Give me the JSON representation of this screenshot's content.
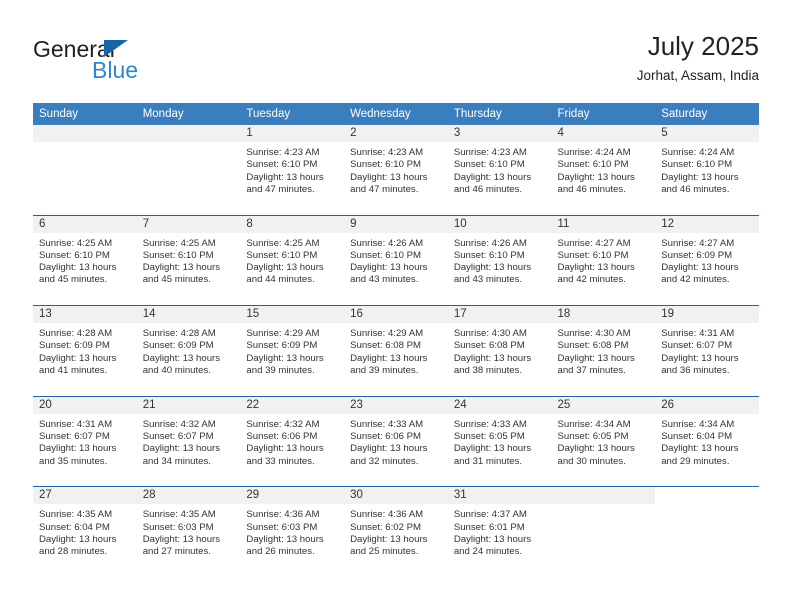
{
  "brand": {
    "name_part1": "General",
    "name_part2": "Blue",
    "triangle_color": "#1565a8",
    "blue_color": "#2d86d0"
  },
  "header": {
    "title": "July 2025",
    "subtitle": "Jorhat, Assam, India"
  },
  "theme": {
    "header_blue": "#3a7ebd",
    "row_rule_blue": "#1f62a8",
    "daynum_band": "#f1f1f1"
  },
  "weekdays": [
    "Sunday",
    "Monday",
    "Tuesday",
    "Wednesday",
    "Thursday",
    "Friday",
    "Saturday"
  ],
  "labels": {
    "sunrise_prefix": "Sunrise:",
    "sunset_prefix": "Sunset:",
    "daylight_prefix": "Daylight:"
  },
  "weeks": [
    [
      {
        "day": "",
        "line1": "",
        "line2": "",
        "line3": "",
        "line4": ""
      },
      {
        "day": "",
        "line1": "",
        "line2": "",
        "line3": "",
        "line4": ""
      },
      {
        "day": "1",
        "line1": "Sunrise: 4:23 AM",
        "line2": "Sunset: 6:10 PM",
        "line3": "Daylight: 13 hours",
        "line4": "and 47 minutes."
      },
      {
        "day": "2",
        "line1": "Sunrise: 4:23 AM",
        "line2": "Sunset: 6:10 PM",
        "line3": "Daylight: 13 hours",
        "line4": "and 47 minutes."
      },
      {
        "day": "3",
        "line1": "Sunrise: 4:23 AM",
        "line2": "Sunset: 6:10 PM",
        "line3": "Daylight: 13 hours",
        "line4": "and 46 minutes."
      },
      {
        "day": "4",
        "line1": "Sunrise: 4:24 AM",
        "line2": "Sunset: 6:10 PM",
        "line3": "Daylight: 13 hours",
        "line4": "and 46 minutes."
      },
      {
        "day": "5",
        "line1": "Sunrise: 4:24 AM",
        "line2": "Sunset: 6:10 PM",
        "line3": "Daylight: 13 hours",
        "line4": "and 46 minutes."
      }
    ],
    [
      {
        "day": "6",
        "line1": "Sunrise: 4:25 AM",
        "line2": "Sunset: 6:10 PM",
        "line3": "Daylight: 13 hours",
        "line4": "and 45 minutes."
      },
      {
        "day": "7",
        "line1": "Sunrise: 4:25 AM",
        "line2": "Sunset: 6:10 PM",
        "line3": "Daylight: 13 hours",
        "line4": "and 45 minutes."
      },
      {
        "day": "8",
        "line1": "Sunrise: 4:25 AM",
        "line2": "Sunset: 6:10 PM",
        "line3": "Daylight: 13 hours",
        "line4": "and 44 minutes."
      },
      {
        "day": "9",
        "line1": "Sunrise: 4:26 AM",
        "line2": "Sunset: 6:10 PM",
        "line3": "Daylight: 13 hours",
        "line4": "and 43 minutes."
      },
      {
        "day": "10",
        "line1": "Sunrise: 4:26 AM",
        "line2": "Sunset: 6:10 PM",
        "line3": "Daylight: 13 hours",
        "line4": "and 43 minutes."
      },
      {
        "day": "11",
        "line1": "Sunrise: 4:27 AM",
        "line2": "Sunset: 6:10 PM",
        "line3": "Daylight: 13 hours",
        "line4": "and 42 minutes."
      },
      {
        "day": "12",
        "line1": "Sunrise: 4:27 AM",
        "line2": "Sunset: 6:09 PM",
        "line3": "Daylight: 13 hours",
        "line4": "and 42 minutes."
      }
    ],
    [
      {
        "day": "13",
        "line1": "Sunrise: 4:28 AM",
        "line2": "Sunset: 6:09 PM",
        "line3": "Daylight: 13 hours",
        "line4": "and 41 minutes."
      },
      {
        "day": "14",
        "line1": "Sunrise: 4:28 AM",
        "line2": "Sunset: 6:09 PM",
        "line3": "Daylight: 13 hours",
        "line4": "and 40 minutes."
      },
      {
        "day": "15",
        "line1": "Sunrise: 4:29 AM",
        "line2": "Sunset: 6:09 PM",
        "line3": "Daylight: 13 hours",
        "line4": "and 39 minutes."
      },
      {
        "day": "16",
        "line1": "Sunrise: 4:29 AM",
        "line2": "Sunset: 6:08 PM",
        "line3": "Daylight: 13 hours",
        "line4": "and 39 minutes."
      },
      {
        "day": "17",
        "line1": "Sunrise: 4:30 AM",
        "line2": "Sunset: 6:08 PM",
        "line3": "Daylight: 13 hours",
        "line4": "and 38 minutes."
      },
      {
        "day": "18",
        "line1": "Sunrise: 4:30 AM",
        "line2": "Sunset: 6:08 PM",
        "line3": "Daylight: 13 hours",
        "line4": "and 37 minutes."
      },
      {
        "day": "19",
        "line1": "Sunrise: 4:31 AM",
        "line2": "Sunset: 6:07 PM",
        "line3": "Daylight: 13 hours",
        "line4": "and 36 minutes."
      }
    ],
    [
      {
        "day": "20",
        "line1": "Sunrise: 4:31 AM",
        "line2": "Sunset: 6:07 PM",
        "line3": "Daylight: 13 hours",
        "line4": "and 35 minutes."
      },
      {
        "day": "21",
        "line1": "Sunrise: 4:32 AM",
        "line2": "Sunset: 6:07 PM",
        "line3": "Daylight: 13 hours",
        "line4": "and 34 minutes."
      },
      {
        "day": "22",
        "line1": "Sunrise: 4:32 AM",
        "line2": "Sunset: 6:06 PM",
        "line3": "Daylight: 13 hours",
        "line4": "and 33 minutes."
      },
      {
        "day": "23",
        "line1": "Sunrise: 4:33 AM",
        "line2": "Sunset: 6:06 PM",
        "line3": "Daylight: 13 hours",
        "line4": "and 32 minutes."
      },
      {
        "day": "24",
        "line1": "Sunrise: 4:33 AM",
        "line2": "Sunset: 6:05 PM",
        "line3": "Daylight: 13 hours",
        "line4": "and 31 minutes."
      },
      {
        "day": "25",
        "line1": "Sunrise: 4:34 AM",
        "line2": "Sunset: 6:05 PM",
        "line3": "Daylight: 13 hours",
        "line4": "and 30 minutes."
      },
      {
        "day": "26",
        "line1": "Sunrise: 4:34 AM",
        "line2": "Sunset: 6:04 PM",
        "line3": "Daylight: 13 hours",
        "line4": "and 29 minutes."
      }
    ],
    [
      {
        "day": "27",
        "line1": "Sunrise: 4:35 AM",
        "line2": "Sunset: 6:04 PM",
        "line3": "Daylight: 13 hours",
        "line4": "and 28 minutes."
      },
      {
        "day": "28",
        "line1": "Sunrise: 4:35 AM",
        "line2": "Sunset: 6:03 PM",
        "line3": "Daylight: 13 hours",
        "line4": "and 27 minutes."
      },
      {
        "day": "29",
        "line1": "Sunrise: 4:36 AM",
        "line2": "Sunset: 6:03 PM",
        "line3": "Daylight: 13 hours",
        "line4": "and 26 minutes."
      },
      {
        "day": "30",
        "line1": "Sunrise: 4:36 AM",
        "line2": "Sunset: 6:02 PM",
        "line3": "Daylight: 13 hours",
        "line4": "and 25 minutes."
      },
      {
        "day": "31",
        "line1": "Sunrise: 4:37 AM",
        "line2": "Sunset: 6:01 PM",
        "line3": "Daylight: 13 hours",
        "line4": "and 24 minutes."
      },
      {
        "day": "",
        "line1": "",
        "line2": "",
        "line3": "",
        "line4": ""
      },
      {
        "day": "",
        "line1": "",
        "line2": "",
        "line3": "",
        "line4": ""
      }
    ]
  ]
}
